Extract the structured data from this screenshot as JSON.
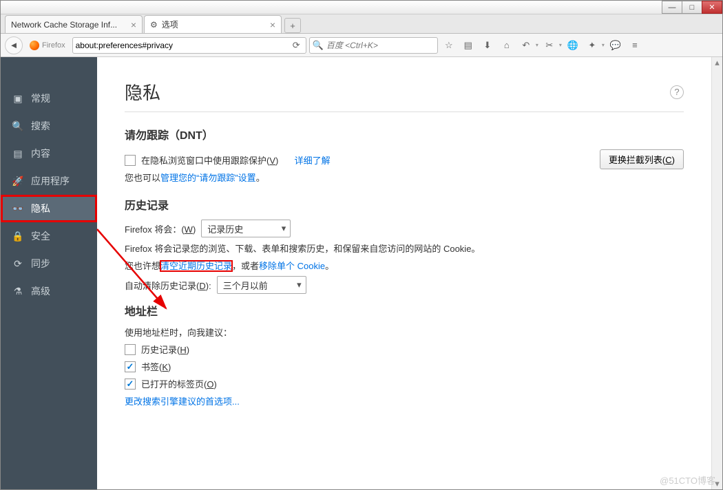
{
  "window": {
    "tabs": [
      {
        "label": "Network Cache Storage Inf...",
        "active": false
      },
      {
        "label": "选项",
        "active": true
      }
    ]
  },
  "toolbar": {
    "firefox_label": "Firefox",
    "url": "about:preferences#privacy",
    "search_placeholder": "百度 <Ctrl+K>"
  },
  "sidebar": {
    "items": [
      {
        "id": "general",
        "label": "常规"
      },
      {
        "id": "search",
        "label": "搜索"
      },
      {
        "id": "content",
        "label": "内容"
      },
      {
        "id": "apps",
        "label": "应用程序"
      },
      {
        "id": "privacy",
        "label": "隐私",
        "selected": true,
        "highlighted": true
      },
      {
        "id": "security",
        "label": "安全"
      },
      {
        "id": "sync",
        "label": "同步"
      },
      {
        "id": "advanced",
        "label": "高级"
      }
    ]
  },
  "page": {
    "title": "隐私",
    "dnt": {
      "heading": "请勿跟踪（DNT）",
      "checkbox_label_pre": "在隐私浏览窗口中使用跟踪保护(",
      "checkbox_key": "V",
      "checkbox_label_post": ")",
      "learn_more": "详细了解",
      "block_list_btn_pre": "更换拦截列表(",
      "block_list_btn_key": "C",
      "block_list_btn_post": ")",
      "manage_pre": "您也可以",
      "manage_link": "管理您的“请勿跟踪”设置",
      "manage_post": "。"
    },
    "history": {
      "heading": "历史记录",
      "will_pre": "Firefox 将会：(",
      "will_key": "W",
      "will_post": ")",
      "mode_value": "记录历史",
      "desc": "Firefox 将会记录您的浏览、下载、表单和搜索历史，和保留来自您访问的网站的 Cookie。",
      "clear_pre": "您也许想",
      "clear_link": "清空近期历史记录",
      "clear_mid": "，或者",
      "remove_cookie_link": "移除单个 Cookie",
      "clear_post": "。",
      "auto_clear_pre": "自动清除历史记录(",
      "auto_clear_key": "D",
      "auto_clear_post": "):",
      "auto_clear_value": "三个月以前"
    },
    "locationbar": {
      "heading": "地址栏",
      "suggest_label": "使用地址栏时，向我建议：",
      "history_pre": "历史记录(",
      "history_key": "H",
      "history_post": ")",
      "bookmarks_pre": "书签(",
      "bookmarks_key": "K",
      "bookmarks_post": ")",
      "opentabs_pre": "已打开的标签页(",
      "opentabs_key": "O",
      "opentabs_post": ")",
      "change_search": "更改搜索引擎建议的首选项..."
    }
  },
  "watermark": "@51CTO博客"
}
